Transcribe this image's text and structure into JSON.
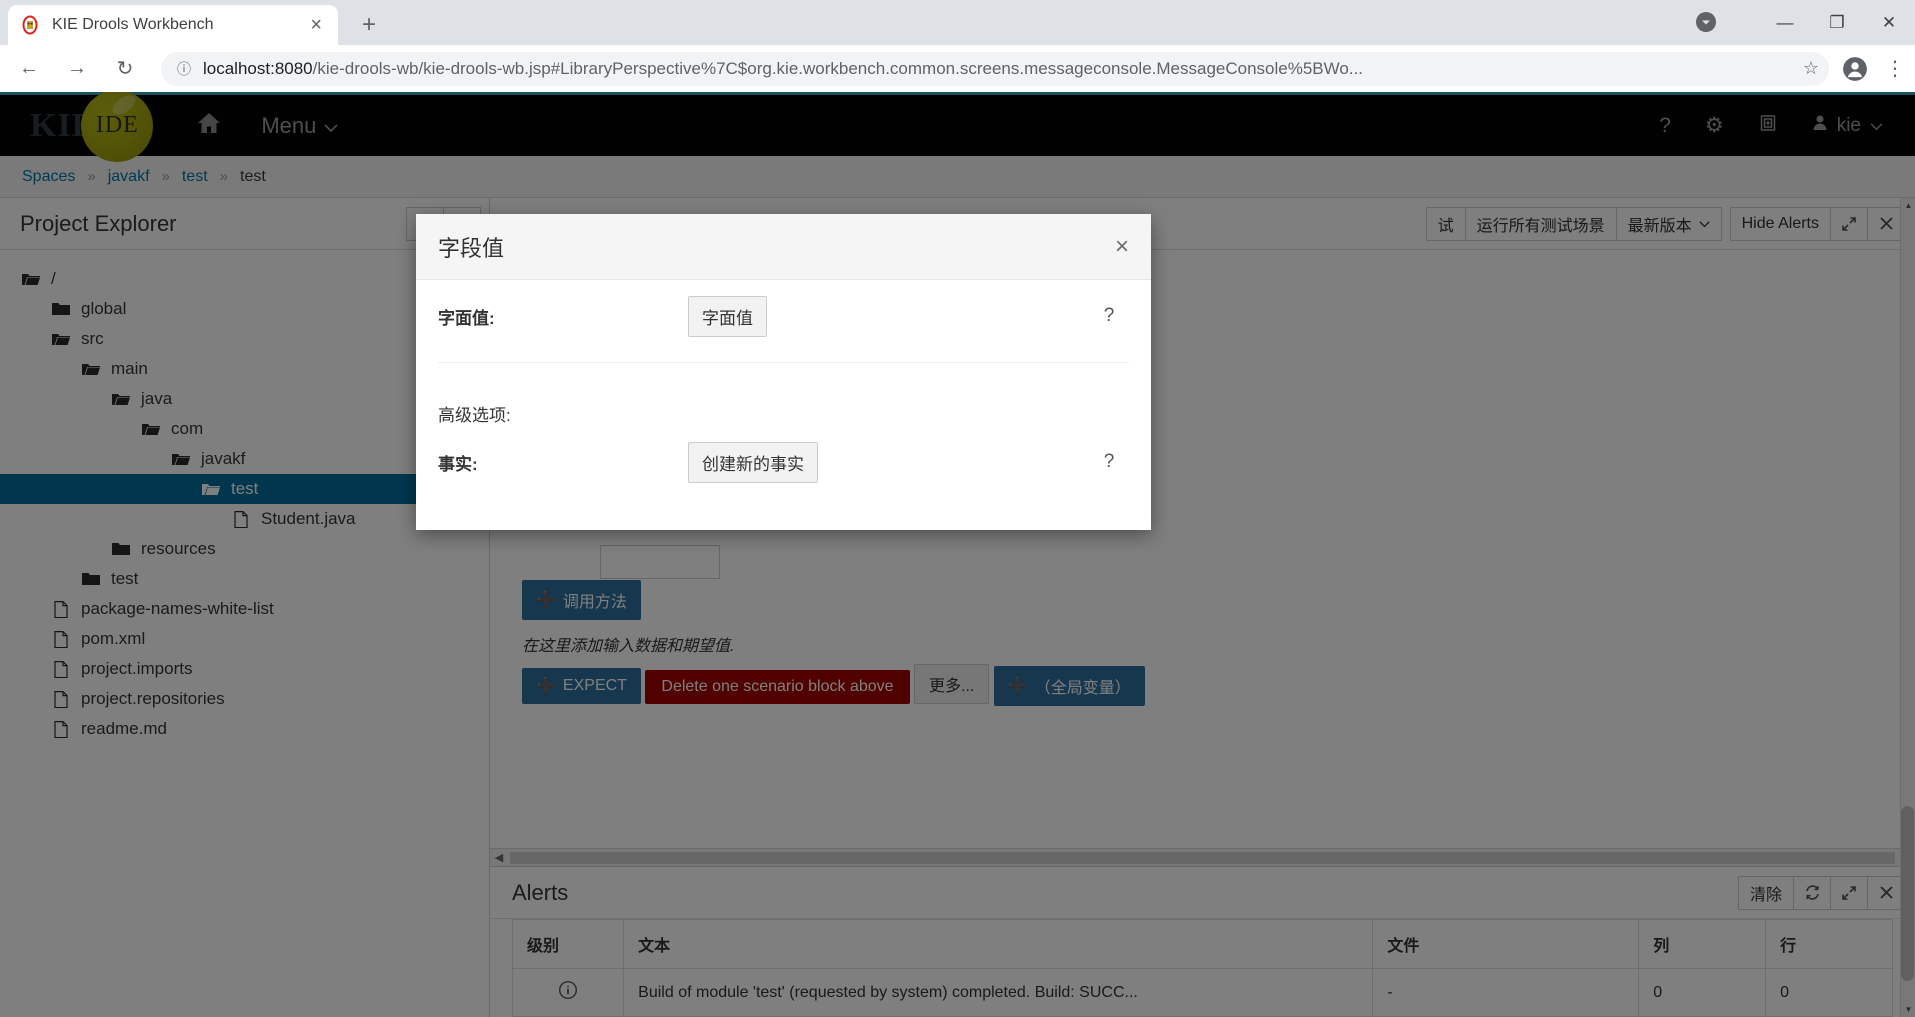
{
  "browser": {
    "tab_title": "KIE Drools Workbench",
    "tab_close": "×",
    "new_tab": "+",
    "back": "←",
    "forward": "→",
    "reload": "↻",
    "secure_icon": "ⓘ",
    "url_host": "localhost:8080",
    "url_rest": "/kie-drools-wb/kie-drools-wb.jsp#LibraryPerspective%7C$org.kie.workbench.common.screens.messageconsole.MessageConsole%5BWo...",
    "star": "☆",
    "kebab": "⋮",
    "minimize": "—",
    "maximize": "❐",
    "close": "✕",
    "profile_chip": "▼"
  },
  "kie_header": {
    "logo_text": "KIE",
    "logo_ball_text": "IDE",
    "home_icon": "home-icon",
    "menu_label": "Menu",
    "menu_caret": "⌄",
    "help_icon": "?",
    "gear_icon": "⚙",
    "kit_icon": "⚕",
    "user_icon": "👤",
    "user_name": "kie",
    "user_caret": "⌄"
  },
  "breadcrumb": {
    "items": [
      {
        "label": "Spaces",
        "link": true
      },
      {
        "label": "javakf",
        "link": true
      },
      {
        "label": "test",
        "link": true
      },
      {
        "label": "test",
        "link": false
      }
    ],
    "separator": "»"
  },
  "explorer": {
    "title": "Project Explorer",
    "refresh_icon": "↻",
    "more_icon": "⋮",
    "tree": [
      {
        "label": "/",
        "icon": "folder-open-icon",
        "indent": 0,
        "selected": false
      },
      {
        "label": "global",
        "icon": "folder-closed-icon",
        "indent": 1,
        "selected": false
      },
      {
        "label": "src",
        "icon": "folder-open-icon",
        "indent": 1,
        "selected": false
      },
      {
        "label": "main",
        "icon": "folder-open-icon",
        "indent": 2,
        "selected": false
      },
      {
        "label": "java",
        "icon": "folder-open-icon",
        "indent": 3,
        "selected": false
      },
      {
        "label": "com",
        "icon": "folder-open-icon",
        "indent": 4,
        "selected": false
      },
      {
        "label": "javakf",
        "icon": "folder-open-icon",
        "indent": 5,
        "selected": false
      },
      {
        "label": "test",
        "icon": "folder-open-icon",
        "indent": 6,
        "selected": true
      },
      {
        "label": "Student.java",
        "icon": "file-icon",
        "indent": 7,
        "selected": false
      },
      {
        "label": "resources",
        "icon": "folder-closed-icon",
        "indent": 3,
        "selected": false
      },
      {
        "label": "test",
        "icon": "folder-closed-icon",
        "indent": 2,
        "selected": false
      },
      {
        "label": "package-names-white-list",
        "icon": "file-icon",
        "indent": 1,
        "selected": false
      },
      {
        "label": "pom.xml",
        "icon": "file-icon",
        "indent": 1,
        "selected": false
      },
      {
        "label": "project.imports",
        "icon": "file-icon",
        "indent": 1,
        "selected": false
      },
      {
        "label": "project.repositories",
        "icon": "file-icon",
        "indent": 1,
        "selected": false
      },
      {
        "label": "readme.md",
        "icon": "file-icon",
        "indent": 1,
        "selected": false
      }
    ]
  },
  "editor_toolbar": {
    "run_all_label": "运行所有测试场景",
    "version_label": "最新版本",
    "version_caret": "⌄",
    "hide_alerts_label": "Hide Alerts",
    "expand_icon": "⤡",
    "close_icon": "✕",
    "truncated_label": "试"
  },
  "scenario": {
    "call_method_btn": "调用方法",
    "hint": "在这里添加输入数据和期望值.",
    "expect_btn": "EXPECT",
    "delete_block_btn": "Delete one scenario block above",
    "more_btn": "更多...",
    "global_var_btn": "（全局变量）",
    "plus": "➕"
  },
  "alerts": {
    "title": "Alerts",
    "clear_label": "清除",
    "refresh_icon": "↻",
    "expand_icon": "⤡",
    "close_icon": "✕",
    "columns": [
      "级别",
      "文本",
      "文件",
      "列",
      "行"
    ],
    "rows": [
      {
        "level_icon": "info-icon",
        "text": "Build of module 'test' (requested by system) completed. Build: SUCC...",
        "file": "-",
        "column": "0",
        "row": "0"
      }
    ]
  },
  "modal": {
    "title": "字段值",
    "close": "×",
    "literal_label": "字面值:",
    "literal_button": "字面值",
    "literal_help": "?",
    "advanced_label": "高级选项:",
    "fact_label": "事实:",
    "fact_button": "创建新的事实",
    "fact_help": "?"
  },
  "colors": {
    "accent_blue": "#0275a5",
    "selection_blue": "#006e9c",
    "btn_blue": "#2f6f9f",
    "btn_red": "#a30000",
    "kie_ball": "#a5a70e",
    "header_rule": "#39a5b7"
  }
}
